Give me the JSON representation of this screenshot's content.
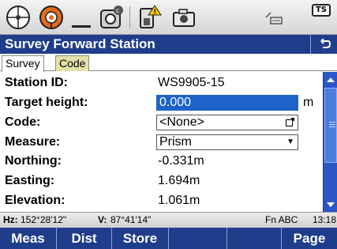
{
  "window_title": "Survey Forward Station",
  "tabs": [
    {
      "label": "Survey"
    },
    {
      "label": "Code"
    }
  ],
  "fields": {
    "station_id": {
      "label": "Station ID:",
      "value": "WS9905-15"
    },
    "target_height": {
      "label": "Target height:",
      "value": "0.000",
      "unit": "m"
    },
    "code": {
      "label": "Code:",
      "value": "<None>"
    },
    "measure": {
      "label": "Measure:",
      "value": "Prism"
    },
    "northing": {
      "label": "Northing:",
      "value": "-0.331m"
    },
    "easting": {
      "label": "Easting:",
      "value": "1.694m"
    },
    "elevation": {
      "label": "Elevation:",
      "value": "1.061m"
    }
  },
  "status": {
    "hz_label": "Hz:",
    "hz_value": "152°28'12\"",
    "v_label": "V:",
    "v_value": "87°41'14\"",
    "input_mode": "Fn ABC",
    "time": "13:18"
  },
  "softkeys": [
    "Meas",
    "Dist",
    "Store",
    "",
    "",
    "Page"
  ],
  "toolbar": {
    "ts_badge": "TS"
  },
  "icons": [
    "target-icon",
    "satellite-icon",
    "underscore-icon",
    "instrument-icon",
    "battery-warning-icon",
    "camera-icon",
    "stylus-icon",
    "ts-badge-icon",
    "back-icon"
  ],
  "colors": {
    "title_bg": "#1f3d8a",
    "selected_field": "#1e64c8",
    "scrollbar": "#2a56c6",
    "tab_inactive": "#e2e2a8"
  }
}
